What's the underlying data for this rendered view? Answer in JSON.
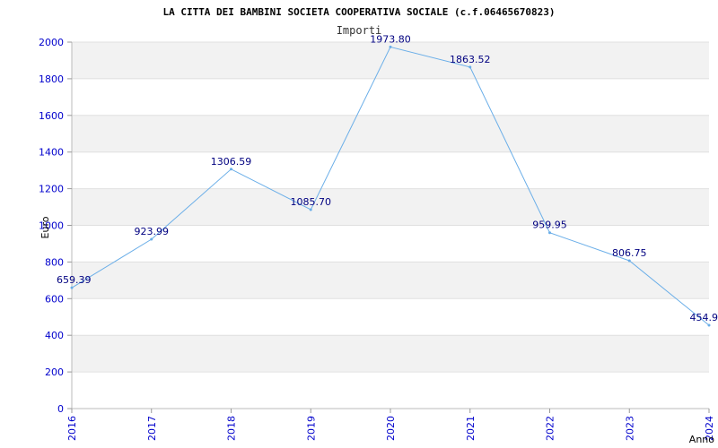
{
  "chart_data": {
    "type": "line",
    "title": "LA CITTA DEI BAMBINI SOCIETA COOPERATIVA SOCIALE (c.f.06465670823)",
    "subtitle": "Importi",
    "xlabel": "Anno",
    "ylabel": "Euro",
    "ylim": [
      0,
      2000
    ],
    "yticks": [
      0,
      200,
      400,
      600,
      800,
      1000,
      1200,
      1400,
      1600,
      1800,
      2000
    ],
    "categories": [
      "2016",
      "2017",
      "2018",
      "2019",
      "2020",
      "2021",
      "2022",
      "2023",
      "2024"
    ],
    "values": [
      659.39,
      923.99,
      1306.59,
      1085.7,
      1973.8,
      1863.52,
      959.95,
      806.75,
      454.9
    ],
    "value_labels": [
      "659.39",
      "923.99",
      "1306.59",
      "1085.70",
      "1973.80",
      "1863.52",
      "959.95",
      "806.75",
      "454.9"
    ],
    "grid": true,
    "colors": {
      "line": "#6aaee8",
      "band": "#f2f2f2",
      "tick": "#0000cc",
      "label": "#000080"
    }
  }
}
